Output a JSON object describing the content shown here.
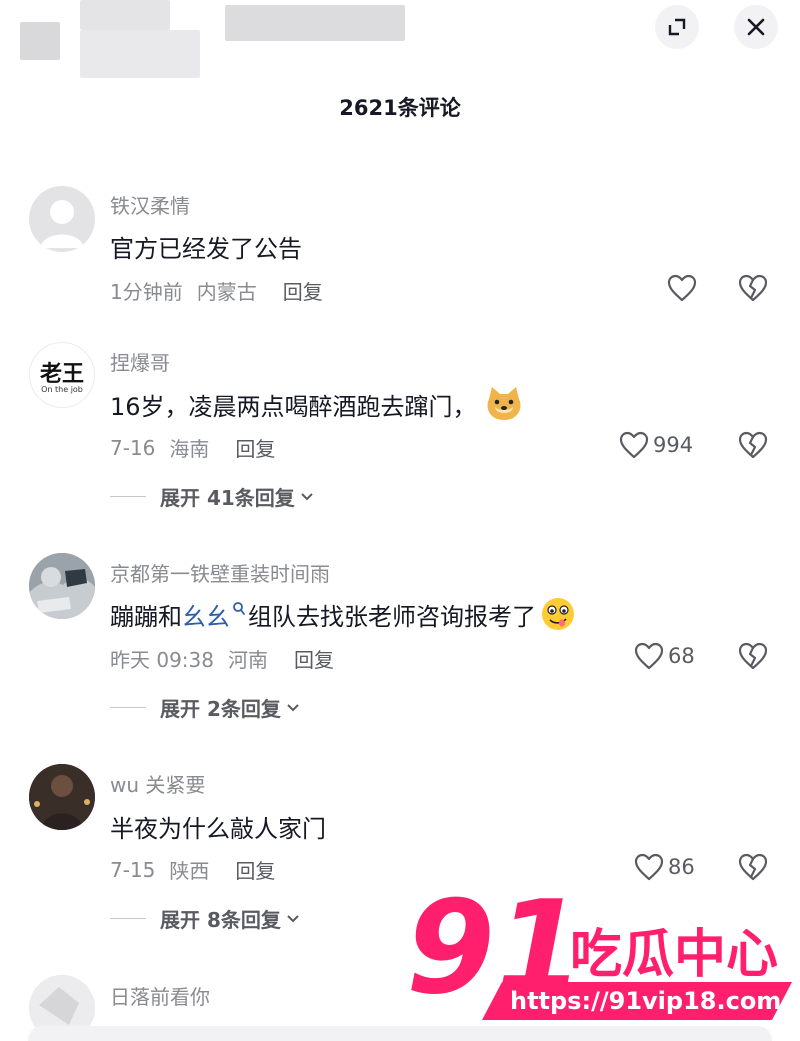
{
  "header": {
    "comment_count_title": "2621条评论"
  },
  "comments": [
    {
      "username": "铁汉柔情",
      "text": "官方已经发了公告",
      "time": "1分钟前",
      "location": "内蒙古",
      "reply_label": "回复",
      "likes": ""
    },
    {
      "username": "捏爆哥",
      "avatar_text": "老王",
      "avatar_subtext": "On the job",
      "text": "16岁，凌晨两点喝醉酒跑去蹿门，",
      "time": "7-16",
      "location": "海南",
      "reply_label": "回复",
      "likes": "994",
      "expand_label": "展开 41条回复"
    },
    {
      "username": "京都第一铁壁重装时间雨",
      "text_before": "蹦蹦和",
      "text_link": "幺幺",
      "text_after": "组队去找张老师咨询报考了",
      "time": "昨天 09:38",
      "location": "河南",
      "reply_label": "回复",
      "likes": "68",
      "expand_label": "展开 2条回复"
    },
    {
      "username": "wu 关紧要",
      "text": "半夜为什么敲人家门",
      "time": "7-15",
      "location": "陕西",
      "reply_label": "回复",
      "likes": "86",
      "expand_label": "展开 8条回复"
    },
    {
      "username": "日落前看你"
    }
  ],
  "watermark": {
    "big": "91",
    "brand": "吃瓜中心",
    "url": "https://91vip18.com"
  },
  "colors": {
    "accent_pink": "#ff1f6d",
    "link_blue": "#2f5fa8",
    "muted_text": "#8a8b91"
  },
  "icons": [
    "expand-icon",
    "close-icon",
    "heart-icon",
    "broken-heart-icon",
    "search-icon",
    "chevron-down-icon"
  ]
}
